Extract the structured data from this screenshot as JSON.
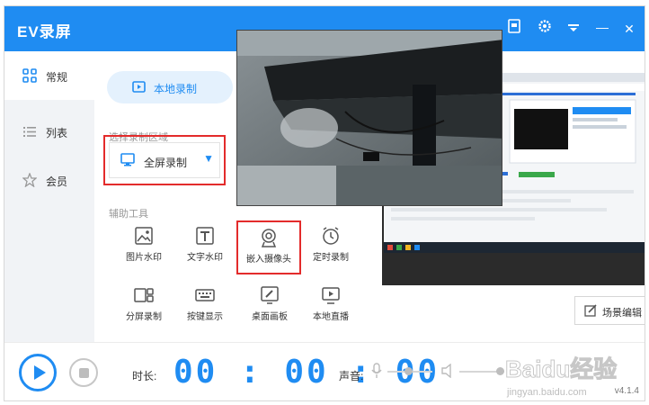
{
  "window": {
    "title": "EV录屏"
  },
  "titlebar": {
    "buttons": [
      "file-icon",
      "gear-icon",
      "menu-icon",
      "minimize-icon",
      "close-icon"
    ],
    "close_glyph": "✕",
    "minimize_glyph": "—"
  },
  "sidebar": {
    "items": [
      {
        "label": "常规",
        "icon": "grid-icon",
        "active": true
      },
      {
        "label": "列表",
        "icon": "list-icon",
        "active": false
      },
      {
        "label": "会员",
        "icon": "star-icon",
        "active": false
      }
    ]
  },
  "main": {
    "mode_tab": "本地录制",
    "region_label": "选择录制区域",
    "region_value": "全屏录制",
    "tools_label": "辅助工具",
    "tools": [
      {
        "label": "图片水印",
        "icon": "image-icon"
      },
      {
        "label": "文字水印",
        "icon": "text-icon"
      },
      {
        "label": "嵌入摄像头",
        "icon": "webcam-icon",
        "highlighted": true
      },
      {
        "label": "定时录制",
        "icon": "alarm-icon"
      },
      {
        "label": "分屏录制",
        "icon": "split-screen-icon"
      },
      {
        "label": "按键显示",
        "icon": "keyboard-icon"
      },
      {
        "label": "桌面画板",
        "icon": "pen-board-icon"
      },
      {
        "label": "本地直播",
        "icon": "live-icon"
      }
    ],
    "scene_edit": "场景编辑"
  },
  "bottombar": {
    "duration_label": "时长:",
    "timer": "00:00:00",
    "volume_label": "声音:",
    "mic_level": 0.45,
    "speaker_level": 0.9,
    "version": "v4.1.4"
  },
  "watermark": {
    "brand": "Baidu经验",
    "url": "jingyan.baidu.com"
  },
  "colors": {
    "accent": "#1f8cf2",
    "highlight": "#e32b2b",
    "sidebar_bg": "#f1f3f6"
  }
}
